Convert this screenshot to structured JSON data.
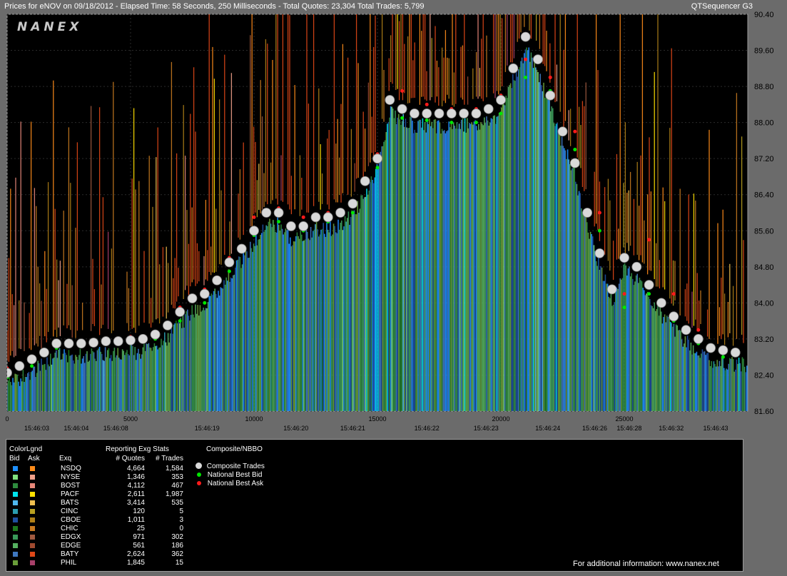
{
  "header": {
    "left": "Prices for  eNOV  on  09/18/2012  -  Elapsed Time: 58 Seconds, 250 Milliseconds  -  Total Quotes: 23,304  Total Trades: 5,799",
    "right": "QTSequencer G3"
  },
  "logo": "NANEX",
  "colors": {
    "background": "#000000",
    "frame": "#6b6b6b",
    "trade_marker": "#d9d9d9",
    "best_bid": "#00e600",
    "best_ask": "#ff1a1a"
  },
  "chart_data": {
    "type": "scatter",
    "title": "",
    "xlabel": "",
    "ylabel": "",
    "xlim": [
      0,
      30000
    ],
    "ylim": [
      81.6,
      90.4
    ],
    "y_ticks": [
      "90.40",
      "89.60",
      "88.80",
      "88.00",
      "87.20",
      "86.40",
      "85.60",
      "84.80",
      "84.00",
      "83.20",
      "82.40",
      "81.60"
    ],
    "x_ticks": [
      "0",
      "5000",
      "10000",
      "15000",
      "20000",
      "25000"
    ],
    "x_tick_values": [
      0,
      5000,
      10000,
      15000,
      20000,
      25000
    ],
    "time_labels": [
      "15:46:03",
      "15:46:04",
      "15:46:08",
      "15:46:19",
      "15:46:20",
      "15:46:21",
      "15:46:22",
      "15:46:23",
      "15:46:24",
      "15:46:26",
      "15:46:28",
      "15:46:32",
      "15:46:43"
    ],
    "time_label_x": [
      1200,
      2800,
      4400,
      8100,
      11700,
      14000,
      17000,
      19400,
      21900,
      23800,
      25200,
      26900,
      28700
    ],
    "grid": true,
    "series": [
      {
        "name": "Composite Trades",
        "x": [
          0,
          500,
          1000,
          1500,
          2000,
          2500,
          3000,
          3500,
          4000,
          4500,
          5000,
          5500,
          6000,
          6500,
          7000,
          7500,
          8000,
          8500,
          9000,
          9500,
          10000,
          10500,
          11000,
          11500,
          12000,
          12500,
          13000,
          13500,
          14000,
          14500,
          15000,
          15500,
          16000,
          16500,
          17000,
          17500,
          18000,
          18500,
          19000,
          19500,
          20000,
          20500,
          21000,
          21500,
          22000,
          22500,
          23000,
          23500,
          24000,
          24500,
          25000,
          25500,
          26000,
          26500,
          27000,
          27500,
          28000,
          28500,
          29000,
          29500
        ],
        "y": [
          82.45,
          82.6,
          82.75,
          82.9,
          83.1,
          83.1,
          83.1,
          83.12,
          83.15,
          83.15,
          83.17,
          83.2,
          83.3,
          83.5,
          83.8,
          84.1,
          84.2,
          84.5,
          84.9,
          85.2,
          85.6,
          86.0,
          86.0,
          85.7,
          85.7,
          85.9,
          85.9,
          86.0,
          86.2,
          86.7,
          87.2,
          88.5,
          88.3,
          88.2,
          88.2,
          88.2,
          88.2,
          88.2,
          88.2,
          88.3,
          88.5,
          89.2,
          89.9,
          89.4,
          88.6,
          87.8,
          87.1,
          86.0,
          85.1,
          84.3,
          85.0,
          84.8,
          84.4,
          84.0,
          83.7,
          83.4,
          83.2,
          83.0,
          82.95,
          82.9
        ]
      },
      {
        "name": "National Best Bid",
        "x": [
          0,
          1000,
          2000,
          3000,
          4000,
          5000,
          6000,
          7000,
          8000,
          9000,
          10000,
          11000,
          12000,
          13000,
          14000,
          15000,
          16000,
          17000,
          18000,
          19000,
          20000,
          21000,
          22000,
          23000,
          24000,
          25000,
          26000,
          27000,
          28000,
          29000
        ],
        "y": [
          82.35,
          82.6,
          83.0,
          83.05,
          83.1,
          83.1,
          83.2,
          83.6,
          84.0,
          84.7,
          85.5,
          85.8,
          85.6,
          85.8,
          86.0,
          87.0,
          88.1,
          88.05,
          88.0,
          88.0,
          88.2,
          89.0,
          88.7,
          87.4,
          85.6,
          83.9,
          84.2,
          83.6,
          83.1,
          82.8
        ]
      },
      {
        "name": "National Best Ask",
        "x": [
          0,
          1000,
          2000,
          3000,
          4000,
          5000,
          6000,
          7000,
          8000,
          9000,
          10000,
          11000,
          12000,
          13000,
          14000,
          15000,
          16000,
          17000,
          18000,
          19000,
          20000,
          21000,
          22000,
          23000,
          24000,
          25000,
          26000,
          27000,
          28000,
          29000
        ],
        "y": [
          82.55,
          82.75,
          83.15,
          83.15,
          83.2,
          83.25,
          83.35,
          83.9,
          84.3,
          85.0,
          85.9,
          86.1,
          85.9,
          86.0,
          86.2,
          87.3,
          88.7,
          88.4,
          88.3,
          88.3,
          88.6,
          89.4,
          89.0,
          87.8,
          86.0,
          84.2,
          85.4,
          84.2,
          83.4,
          83.0
        ]
      }
    ]
  },
  "legend": {
    "col_legend": "ColorLgnd",
    "bid_hdr": "Bid",
    "ask_hdr": "Ask",
    "exq_hdr": "Exq",
    "stats_title": "Reporting Exg Stats",
    "quotes_hdr": "# Quotes",
    "trades_hdr": "# Trades",
    "comp_title": "Composite/NBBO",
    "comp_trades": "Composite Trades",
    "nbb": "National Best Bid",
    "nba": "National Best Ask",
    "footer": "For additional information: www.nanex.net"
  },
  "exchanges": [
    {
      "name": "NSDQ",
      "quotes": "4,664",
      "trades": "1,584",
      "bid": "#1e90ff",
      "ask": "#ff8c1a"
    },
    {
      "name": "NYSE",
      "quotes": "1,346",
      "trades": "353",
      "bid": "#7fe07f",
      "ask": "#f0a08a"
    },
    {
      "name": "BOST",
      "quotes": "4,112",
      "trades": "467",
      "bid": "#2e8b3e",
      "ask": "#e8887a"
    },
    {
      "name": "PACF",
      "quotes": "2,611",
      "trades": "1,987",
      "bid": "#00e5ee",
      "ask": "#ffe000"
    },
    {
      "name": "BATS",
      "quotes": "3,414",
      "trades": "535",
      "bid": "#4fb8ee",
      "ask": "#f0c050"
    },
    {
      "name": "CINC",
      "quotes": "120",
      "trades": "5",
      "bid": "#2a9db0",
      "ask": "#b8a020"
    },
    {
      "name": "CBOE",
      "quotes": "1,011",
      "trades": "3",
      "bid": "#1f4fa0",
      "ask": "#b08018"
    },
    {
      "name": "CHIC",
      "quotes": "25",
      "trades": "0",
      "bid": "#1e7a1e",
      "ask": "#c87a20"
    },
    {
      "name": "EDGX",
      "quotes": "971",
      "trades": "302",
      "bid": "#3a9a5a",
      "ask": "#a05a40"
    },
    {
      "name": "EDGE",
      "quotes": "561",
      "trades": "186",
      "bid": "#55b060",
      "ask": "#a04a30"
    },
    {
      "name": "BATY",
      "quotes": "2,624",
      "trades": "362",
      "bid": "#3f78c0",
      "ask": "#e04818"
    },
    {
      "name": "PHIL",
      "quotes": "1,845",
      "trades": "15",
      "bid": "#6a9e3a",
      "ask": "#a8406a"
    }
  ]
}
